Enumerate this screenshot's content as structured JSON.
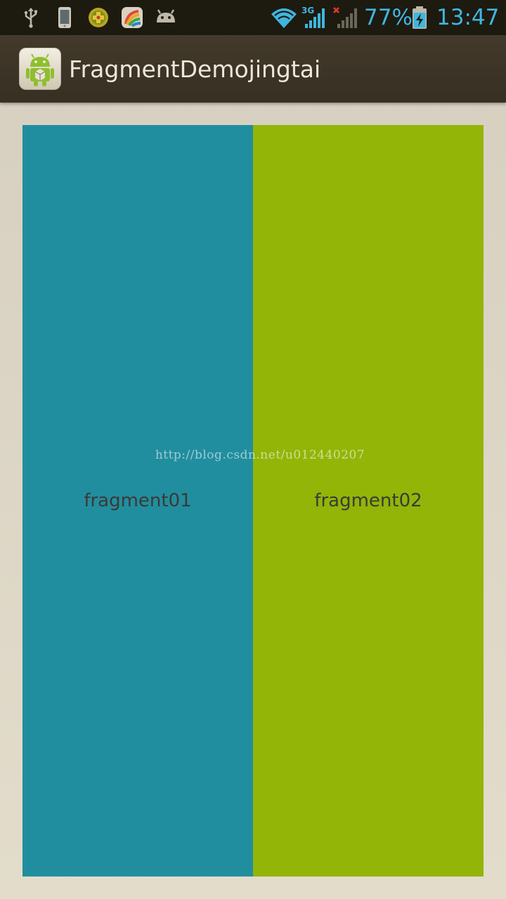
{
  "status_bar": {
    "icons": [
      "usb-icon",
      "phone-icon",
      "game-app-icon",
      "multicolor-app-icon",
      "android-icon",
      "wifi-icon",
      "signal-3g-icon",
      "signal-no-sim-icon",
      "battery-charging-icon"
    ],
    "network_type": "3G",
    "battery_percent": "77%",
    "time": "13:47",
    "accent_color": "#3fb6df"
  },
  "action_bar": {
    "title": "FragmentDemojingtai",
    "app_icon": "android-app-icon"
  },
  "fragments": [
    {
      "label": "fragment01",
      "color": "#218e9f"
    },
    {
      "label": "fragment02",
      "color": "#92b508"
    }
  ],
  "watermark": "http://blog.csdn.net/u012440207"
}
